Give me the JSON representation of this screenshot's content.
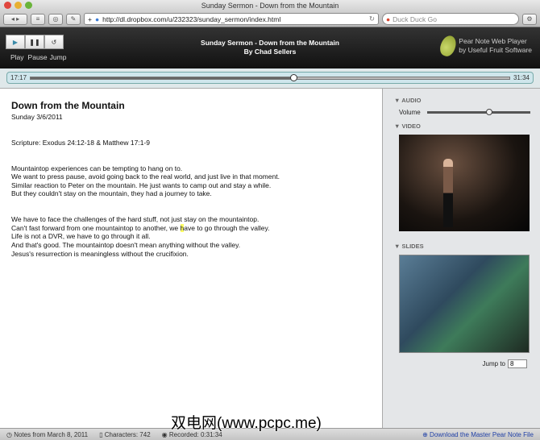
{
  "window": {
    "title": "Sunday Sermon - Down from the Mountain"
  },
  "browser": {
    "url": "http://dl.dropbox.com/u/232323/sunday_sermon/index.html",
    "search_placeholder": "Duck Duck Go",
    "add": "+"
  },
  "player": {
    "play": "Play",
    "pause": "Pause",
    "jump": "Jump",
    "title": "Sunday Sermon - Down from the Mountain",
    "author": "By Chad Sellers",
    "brand_line1": "Pear Note Web Player",
    "brand_line2": "by Useful Fruit Software",
    "current_time": "17:17",
    "total_time": "31:34",
    "progress": 0.548
  },
  "notes": {
    "title": "Down from the Mountain",
    "date": "Sunday 3/6/2011",
    "scripture": "Scripture: Exodus 24:12-18 & Matthew 17:1-9",
    "para1": [
      "Mountaintop experiences can be tempting to hang on to.",
      "We want to press pause, avoid going back to the real world, and just live in that moment.",
      "Similar reaction to Peter on the mountain. He just wants to camp out and stay a while.",
      "But they couldn't stay on the mountain, they had a journey to take."
    ],
    "para2_line1": "We have to face the challenges of the hard stuff, not just stay on the mountaintop.",
    "para2_line2_a": "Can't fast forward from one mountaintop to another, we ",
    "para2_line2_hl": "h",
    "para2_line2_b": "ave to go through the valley.",
    "para2_rest": [
      "Life is not a DVR, we have to go through it all.",
      "And that's good. The mountaintop doesn't mean anything without the valley.",
      "Jesus's resurrection is meaningless without the crucifixion."
    ]
  },
  "sidebar": {
    "audio": "AUDIO",
    "volume_label": "Volume",
    "volume": 0.6,
    "video": "VIDEO",
    "slides": "SLIDES",
    "jump_label": "Jump to",
    "jump_value": "8"
  },
  "status": {
    "notes_date": "Notes from March 8, 2011",
    "characters": "Characters: 742",
    "recorded": "Recorded: 0:31:34",
    "download": "Download the Master Pear Note File"
  },
  "watermark": "双电网(www.pcpc.me)"
}
